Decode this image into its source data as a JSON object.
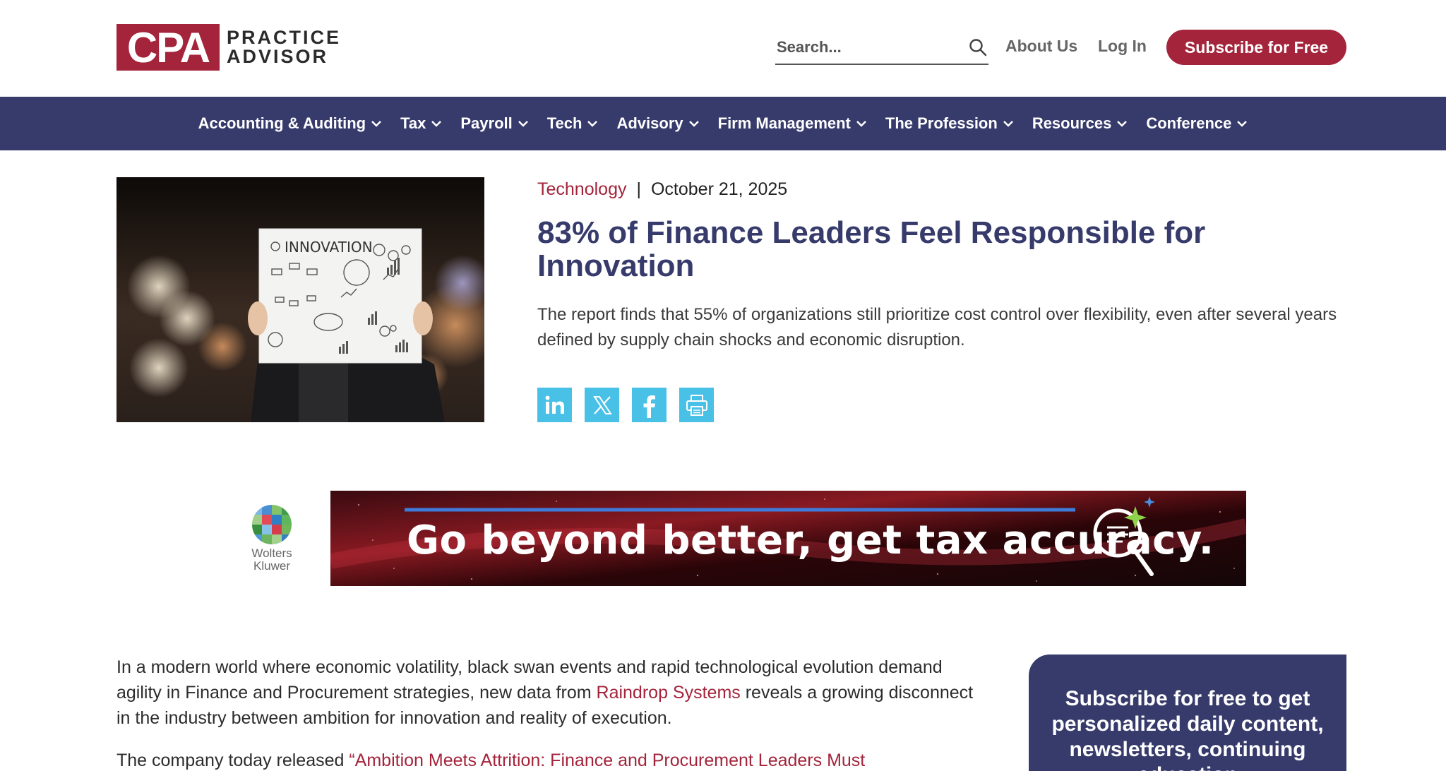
{
  "header": {
    "logo_mark": "CPA",
    "logo_line1": "PRACTICE",
    "logo_line2": "ADVISOR",
    "search_placeholder": "Search...",
    "about_label": "About Us",
    "login_label": "Log In",
    "subscribe_label": "Subscribe for Free"
  },
  "nav": {
    "items": [
      {
        "label": "Accounting & Auditing"
      },
      {
        "label": "Tax"
      },
      {
        "label": "Payroll"
      },
      {
        "label": "Tech"
      },
      {
        "label": "Advisory"
      },
      {
        "label": "Firm Management"
      },
      {
        "label": "The Profession"
      },
      {
        "label": "Resources"
      },
      {
        "label": "Conference"
      }
    ]
  },
  "article": {
    "category": "Technology",
    "separator": "|",
    "date": "October 21, 2025",
    "title": "83% of Finance Leaders Feel Responsible for Innovation",
    "dek": "The report finds that 55% of organizations still prioritize cost control over flexibility, even after several years defined by supply chain shocks and economic disruption.",
    "hero_image_text": "INNOVATION",
    "share": {
      "linkedin_icon": "linkedin-icon",
      "x_icon": "x-icon",
      "facebook_icon": "facebook-icon",
      "print_icon": "print-icon"
    },
    "body": {
      "p1_before": "In a modern world where economic volatility, black swan events and rapid technological evolution demand agility in Finance and Procurement strategies, new data from ",
      "p1_link": "Raindrop Systems",
      "p1_after": " reveals a growing disconnect in the industry between ambition for innovation and reality of execution.",
      "p2_before": "The company today released ",
      "p2_link": "“Ambition Meets Attrition: Finance and Procurement Leaders Must"
    }
  },
  "ad": {
    "sponsor_line1": "Wolters",
    "sponsor_line2": "Kluwer",
    "headline": "Go beyond better, get tax accuracy."
  },
  "sidebar": {
    "cta_text": "Subscribe for free to get personalized daily content, newsletters, continuing education"
  },
  "colors": {
    "brand_red": "#a3243b",
    "nav_navy": "#373b6b",
    "share_blue": "#49c0e6"
  }
}
